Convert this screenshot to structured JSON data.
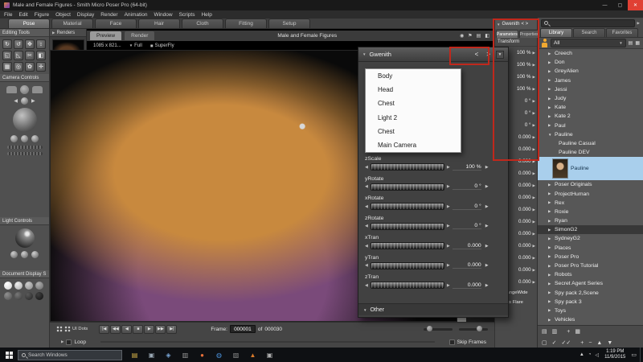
{
  "window": {
    "title": "Male and Female Figures - Smith Micro Poser Pro  (64-bit)",
    "menus": [
      "File",
      "Edit",
      "Figure",
      "Object",
      "Display",
      "Render",
      "Animation",
      "Window",
      "Scripts",
      "Help"
    ],
    "minimize_glyph": "—",
    "maximize_glyph": "▢",
    "close_glyph": "✕"
  },
  "mode_tabs": [
    {
      "label": "Pose",
      "cls": "active"
    },
    {
      "label": "Material"
    },
    {
      "label": "Face"
    },
    {
      "label": "Hair"
    },
    {
      "label": "Cloth"
    },
    {
      "label": "Fitting"
    },
    {
      "label": "Setup"
    }
  ],
  "left_panel": {
    "editing_tools_label": "Editing Tools",
    "tools": [
      {
        "name": "rotate",
        "glyph": "↻"
      },
      {
        "name": "twist",
        "glyph": "↺"
      },
      {
        "name": "translate-pull",
        "glyph": "✥"
      },
      {
        "name": "translate-in-out",
        "glyph": "↕"
      },
      {
        "name": "scale",
        "glyph": "◱"
      },
      {
        "name": "taper",
        "glyph": "◺"
      },
      {
        "name": "chain-break",
        "glyph": "✂"
      },
      {
        "name": "color",
        "glyph": "◧"
      },
      {
        "name": "grouping",
        "glyph": "▦"
      },
      {
        "name": "view-magnifier",
        "glyph": "◎"
      },
      {
        "name": "morphing-tool",
        "glyph": "✿"
      },
      {
        "name": "direct-manipulation",
        "glyph": "✛"
      }
    ],
    "camera_controls_label": "Camera Controls",
    "light_controls_label": "Light Controls",
    "document_display_label": "Document Display S"
  },
  "renders_panel": {
    "label": "Renders"
  },
  "viewport": {
    "preview_tab": "Preview",
    "render_tab": "Render",
    "title": "Male and Female Figures",
    "resolution": "1085 x 821...",
    "zoom": "Full",
    "renderer": "SuperFly",
    "corner_icons": [
      {
        "name": "camera-icon",
        "glyph": "◉"
      },
      {
        "name": "flag-icon",
        "glyph": "⚑"
      },
      {
        "name": "layers-icon",
        "glyph": "▤"
      },
      {
        "name": "shading-icon",
        "glyph": "◧"
      }
    ]
  },
  "floating_panel": {
    "title": "Gwenith",
    "nav_left": "<",
    "nav_right": ">",
    "menu_glyph": "▼",
    "dropdown_items": [
      "Body",
      "Head",
      "Chest",
      "Light 2",
      "Chest",
      "Main Camera"
    ],
    "dials": [
      {
        "label": "zScale",
        "value": "100 %"
      },
      {
        "label": "yRotate",
        "value": "0 °"
      },
      {
        "label": "xRotate",
        "value": "0 °"
      },
      {
        "label": "zRotate",
        "value": "0 °"
      },
      {
        "label": "xTran",
        "value": "0.000"
      },
      {
        "label": "yTran",
        "value": "0.000"
      },
      {
        "label": "zTran",
        "value": "0.000"
      }
    ],
    "other_label": "Other"
  },
  "params_panel": {
    "title": "Gwenith",
    "nav": "< >",
    "tabs": [
      {
        "label": "Parameters",
        "cls": "active"
      },
      {
        "label": "Properties"
      }
    ],
    "section_label": "Transform",
    "values": [
      "100 %",
      "100 %",
      "100 %",
      "100 %",
      "0 °",
      "0 °",
      "0 °",
      "0.000",
      "0.000",
      "0.000",
      "0.000",
      "0.000",
      "0.000",
      "0.000",
      "0.000",
      "0.000",
      "0.000",
      "0.000",
      "0.000",
      "0.000"
    ],
    "extra_labels": [
      "Fit-RangeWide",
      "Chests Flare"
    ]
  },
  "library": {
    "tabs": [
      {
        "label": "Library",
        "cls": "active"
      },
      {
        "label": "Search"
      },
      {
        "label": "Favorites"
      }
    ],
    "filter_value": "All",
    "items": [
      {
        "label": "Creech"
      },
      {
        "label": "Don"
      },
      {
        "label": "GreyAlien"
      },
      {
        "label": "James"
      },
      {
        "label": "Jessi"
      },
      {
        "label": "Judy"
      },
      {
        "label": "Kate"
      },
      {
        "label": "Kate 2"
      },
      {
        "label": "Paul"
      },
      {
        "label": "Pauline",
        "cls": "expanded"
      },
      {
        "label": "Pauline Casual",
        "cls": "subitem"
      },
      {
        "label": "Pauline DEV",
        "cls": "subitem"
      },
      {
        "label": "Pauline",
        "cls": "thumb"
      },
      {
        "label": "Poser Originals"
      },
      {
        "label": "ProjectHuman"
      },
      {
        "label": "Rex"
      },
      {
        "label": "Roxie"
      },
      {
        "label": "Ryan"
      },
      {
        "label": "SimonG2",
        "cls": "dark"
      },
      {
        "label": "SydneyG2"
      },
      {
        "label": "Places"
      },
      {
        "label": "Poser Pro"
      },
      {
        "label": "Poser Pro Tutorial"
      },
      {
        "label": "Robots"
      },
      {
        "label": "Secret Agent Series"
      },
      {
        "label": "Spy pack 2,Scene"
      },
      {
        "label": "Spy pack 3"
      },
      {
        "label": "Toys"
      },
      {
        "label": "Vehicles"
      }
    ],
    "foot_icons_row1": [
      {
        "name": "folder-icon",
        "glyph": "▤"
      },
      {
        "name": "folder-add-icon",
        "glyph": "▥"
      },
      {
        "name": "spacer",
        "glyph": ""
      },
      {
        "name": "add-icon",
        "glyph": "+"
      },
      {
        "name": "grid-view-icon",
        "glyph": "▦"
      }
    ],
    "foot_icons_row2": [
      {
        "name": "checkbox-icon",
        "glyph": "▢"
      },
      {
        "name": "check-icon",
        "glyph": "✓"
      },
      {
        "name": "double-check-icon",
        "glyph": "✓✓"
      },
      {
        "name": "spacer",
        "glyph": ""
      },
      {
        "name": "plus-icon",
        "glyph": "+"
      },
      {
        "name": "minus-icon",
        "glyph": "−"
      },
      {
        "name": "up-icon",
        "glyph": "▲"
      },
      {
        "name": "down-icon",
        "glyph": "▼"
      }
    ]
  },
  "timeline": {
    "ui_dots_label": "UI Dots",
    "transport": [
      {
        "name": "go-to-start",
        "glyph": "|◀"
      },
      {
        "name": "step-back",
        "glyph": "◀◀"
      },
      {
        "name": "play-reverse",
        "glyph": "◀"
      },
      {
        "name": "stop",
        "glyph": "■"
      },
      {
        "name": "play",
        "glyph": "▶"
      },
      {
        "name": "step-forward",
        "glyph": "▶▶"
      },
      {
        "name": "go-to-end",
        "glyph": "▶|"
      }
    ],
    "frame_label": "Frame:",
    "frame_value": "000001",
    "of_label": "of",
    "total_frames": "000030",
    "loop_label": "Loop",
    "skip_frames_label": "Skip Frames"
  },
  "taskbar": {
    "search_text": "Search Windows",
    "apps": [
      {
        "name": "app-icon",
        "glyph": "▤",
        "color": "#d8b44a"
      },
      {
        "name": "app-icon",
        "glyph": "▣",
        "color": "#9aa8b4"
      },
      {
        "name": "app-icon",
        "glyph": "◈",
        "color": "#7aa7d8"
      },
      {
        "name": "app-icon",
        "glyph": "▥",
        "color": "#9a9a9a"
      },
      {
        "name": "app-icon",
        "glyph": "●",
        "color": "#e8703a"
      },
      {
        "name": "app-icon",
        "glyph": "◍",
        "color": "#4a90d8"
      },
      {
        "name": "app-icon",
        "glyph": "▧",
        "color": "#8a8a8a"
      },
      {
        "name": "app-icon",
        "glyph": "▲",
        "color": "#d87a2a"
      },
      {
        "name": "app-icon",
        "glyph": "▣",
        "color": "#b0b0b0"
      }
    ],
    "tray": [
      {
        "name": "hidden-icons-chevron",
        "glyph": "▲"
      },
      {
        "name": "network-icon",
        "glyph": "◔"
      },
      {
        "name": "volume-icon",
        "glyph": "◁"
      }
    ],
    "time": "1:19 PM",
    "date": "11/9/2015",
    "action_center_glyph": "▭"
  },
  "annotations": {
    "highlight_color": "#c0281c"
  }
}
